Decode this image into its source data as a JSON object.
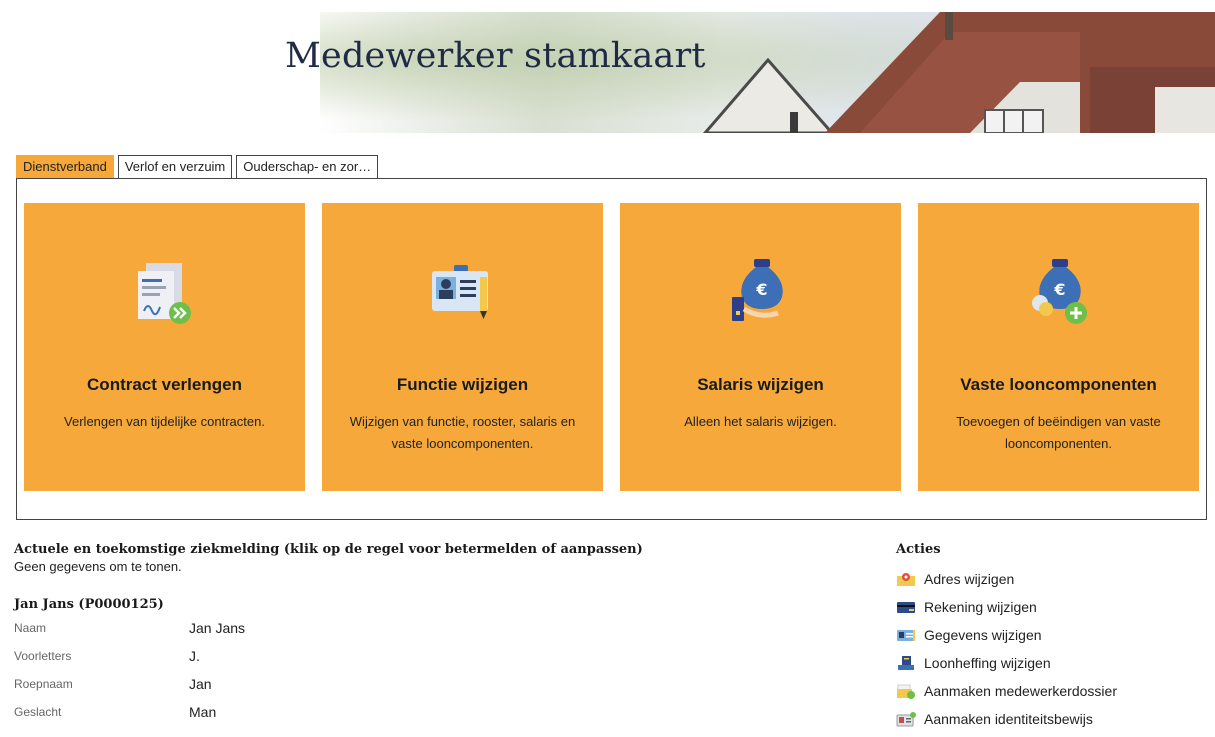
{
  "header": {
    "title": "Medewerker stamkaart"
  },
  "tabs": [
    {
      "label": "Dienstverband",
      "active": true
    },
    {
      "label": "Verlof en verzuim",
      "active": false
    },
    {
      "label": "Ouderschap- en zor…",
      "active": false
    }
  ],
  "tiles": [
    {
      "title": "Contract verlengen",
      "description": "Verlengen van tijdelijke contracten.",
      "icon": "contract-icon"
    },
    {
      "title": "Functie wijzigen",
      "description": "Wijzigen van functie, rooster, salaris en vaste looncomponenten.",
      "icon": "id-badge-icon"
    },
    {
      "title": "Salaris wijzigen",
      "description": "Alleen het salaris wijzigen.",
      "icon": "money-bag-icon"
    },
    {
      "title": "Vaste looncomponenten",
      "description": "Toevoegen of beëindigen van vaste looncomponenten.",
      "icon": "money-bag-add-icon"
    }
  ],
  "sick": {
    "title": "Actuele en toekomstige ziekmelding (klik op de regel voor betermelden of aanpassen)",
    "empty": "Geen gegevens om te tonen."
  },
  "person": {
    "title": "Jan Jans (P0000125)",
    "fields": [
      {
        "label": "Naam",
        "value": "Jan Jans"
      },
      {
        "label": "Voorletters",
        "value": "J."
      },
      {
        "label": "Roepnaam",
        "value": "Jan"
      },
      {
        "label": "Geslacht",
        "value": "Man"
      }
    ]
  },
  "actions": {
    "title": "Acties",
    "items": [
      {
        "label": "Adres wijzigen",
        "icon": "map-pin-icon"
      },
      {
        "label": "Rekening wijzigen",
        "icon": "credit-card-icon"
      },
      {
        "label": "Gegevens wijzigen",
        "icon": "id-card-icon"
      },
      {
        "label": "Loonheffing wijzigen",
        "icon": "tax-document-icon"
      },
      {
        "label": "Aanmaken medewerkerdossier",
        "icon": "folder-add-icon"
      },
      {
        "label": "Aanmaken identiteitsbewijs",
        "icon": "identity-card-icon"
      }
    ]
  },
  "colors": {
    "accent": "#f6a93a",
    "title": "#1f2a44"
  }
}
